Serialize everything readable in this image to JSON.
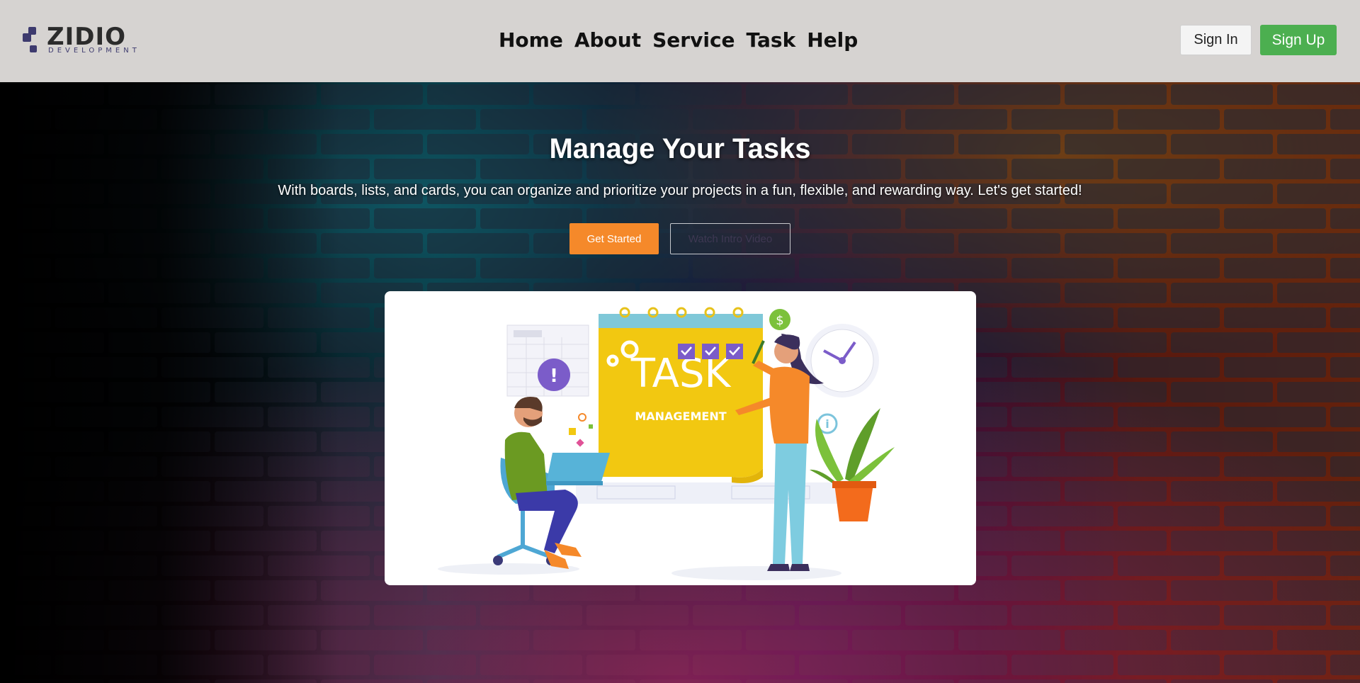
{
  "header": {
    "logo_word": "ZIDIO",
    "logo_sub": "DEVELOPMENT",
    "nav": [
      {
        "label": "Home"
      },
      {
        "label": "About"
      },
      {
        "label": "Service"
      },
      {
        "label": "Task"
      },
      {
        "label": "Help"
      }
    ],
    "signin_label": "Sign In",
    "signup_label": "Sign Up"
  },
  "hero": {
    "title": "Manage Your Tasks",
    "subtitle": "With boards, lists, and cards, you can organize and prioritize your projects in a fun, flexible, and rewarding way. Let's get started!",
    "get_started_label": "Get Started",
    "video_label": "Watch Intro Video"
  },
  "illustration": {
    "board_title": "TASK",
    "board_subtitle": "MANAGEMENT",
    "dollar_badge": "$",
    "alert_badge": "!",
    "info_badge": "i"
  },
  "colors": {
    "header_bg": "#d6d3d1",
    "signup_green": "#4caf50",
    "cta_orange": "#f5892a",
    "board_yellow": "#f2c811",
    "accent_purple": "#7b5cc9"
  }
}
